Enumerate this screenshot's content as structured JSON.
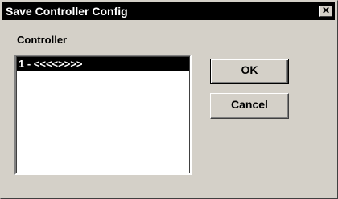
{
  "window": {
    "title": "Save Controller Config",
    "close_glyph": "✕"
  },
  "controller": {
    "label": "Controller",
    "items": [
      {
        "label": "1 - <<<<>>>>",
        "selected": true
      }
    ]
  },
  "buttons": {
    "ok_label": "OK",
    "cancel_label": "Cancel"
  },
  "colors": {
    "titlebar_bg": "#000000",
    "titlebar_text": "#ffffff",
    "dialog_bg": "#d4d0c8",
    "selection_bg": "#000000",
    "selection_text": "#ffffff"
  }
}
